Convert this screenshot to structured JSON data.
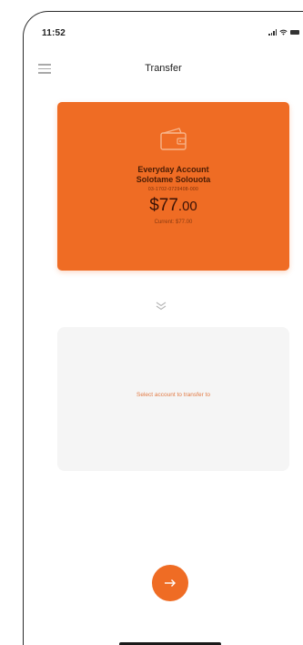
{
  "status_bar": {
    "time": "11:52"
  },
  "nav": {
    "title": "Transfer",
    "menu_icon": "hamburger-menu-icon"
  },
  "from_account": {
    "icon": "wallet-icon",
    "name": "Everyday Account",
    "holder": "Solotame Solouota",
    "number": "03-1702-0729408-000",
    "balance_main": "$77",
    "balance_cents": ".00",
    "current_balance": "Current: $77.00"
  },
  "swap": {
    "icon": "chevron-double-down-icon"
  },
  "to_account": {
    "prompt": "Select account to transfer to"
  },
  "next_button": {
    "icon": "arrow-right-icon"
  },
  "colors": {
    "accent": "#ef6c24",
    "card_text": "#4a1c04",
    "destination_bg": "#f5f5f5"
  }
}
